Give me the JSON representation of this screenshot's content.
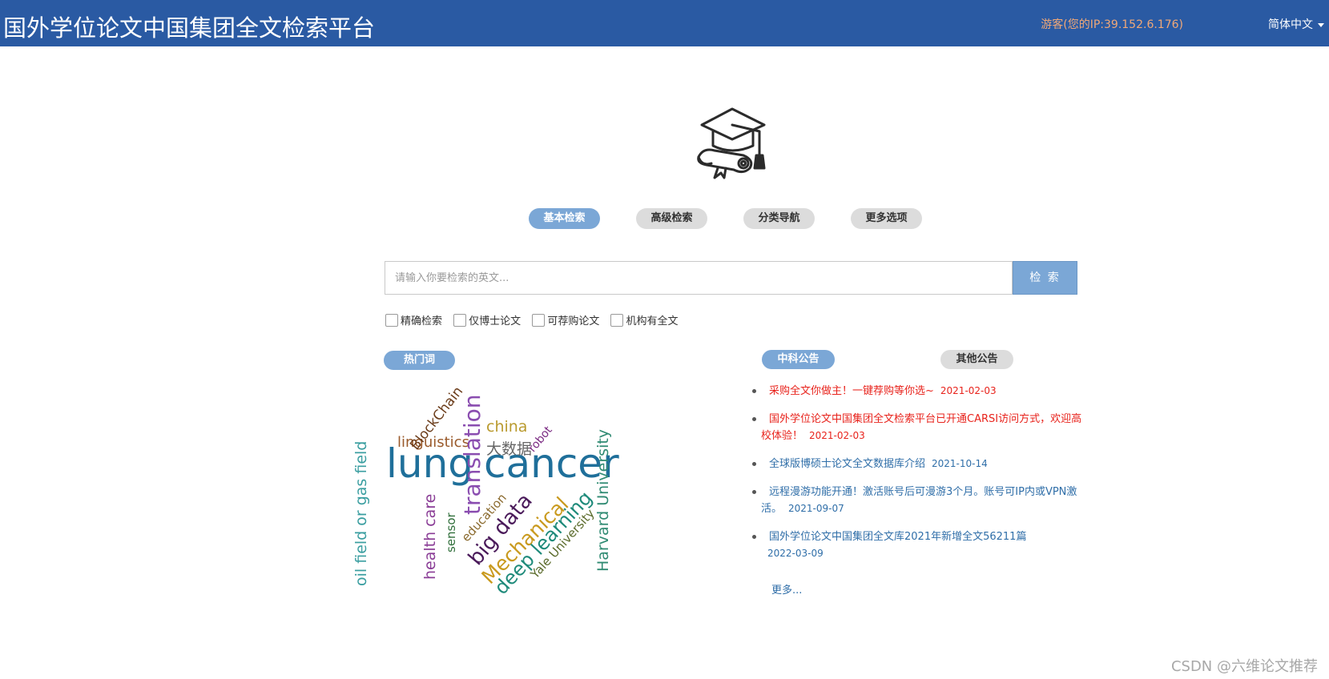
{
  "header": {
    "title": "国外学位论文中国集团全文检索平台",
    "visitor_info": "游客(您的IP:39.152.6.176)",
    "language": "简体中文"
  },
  "logo": {
    "icon": "graduation-cap-icon"
  },
  "tabs": [
    {
      "label": "基本检索",
      "active": true
    },
    {
      "label": "高级检索",
      "active": false
    },
    {
      "label": "分类导航",
      "active": false
    },
    {
      "label": "更多选项",
      "active": false
    }
  ],
  "search": {
    "placeholder": "请输入你要检索的英文...",
    "value": "",
    "button_label": "检 索"
  },
  "options": [
    {
      "label": "精确检索",
      "checked": false
    },
    {
      "label": "仅博士论文",
      "checked": false
    },
    {
      "label": "可荐购论文",
      "checked": false
    },
    {
      "label": "机构有全文",
      "checked": false
    }
  ],
  "hotwords": {
    "tab_label": "热门词",
    "words": [
      "lung",
      "cancer",
      "translation",
      "BlockChain",
      "linguistics",
      "china",
      "大数据",
      "robot",
      "oil field or gas field",
      "health care",
      "sensor",
      "education",
      "big data",
      "Mechanical",
      "deep learning",
      "Yale University",
      "Harvard University"
    ]
  },
  "announcements": {
    "tabs": [
      {
        "label": "中科公告",
        "active": true
      },
      {
        "label": "其他公告",
        "active": false
      }
    ],
    "items": [
      {
        "text": "采购全文你做主！一键荐购等你选~",
        "date": "2021-02-03",
        "color": "#e8231c"
      },
      {
        "text": "国外学位论文中国集团全文检索平台已开通CARSI访问方式，欢迎高校体验！",
        "date": "2021-02-03",
        "color": "#e8231c"
      },
      {
        "text": "全球版博硕士论文全文数据库介绍",
        "date": "2021-10-14",
        "color": "#2f6ea8"
      },
      {
        "text": "远程漫游功能开通！激活账号后可漫游3个月。账号可IP内或VPN激活。",
        "date": "2021-09-07",
        "color": "#2f6ea8"
      },
      {
        "text": "国外学位论文中国集团全文库2021年新增全文56211篇",
        "date": "2022-03-09",
        "color": "#2f6ea8"
      }
    ],
    "more_label": "更多..."
  },
  "watermark": "CSDN @六维论文推荐",
  "colors": {
    "header_bg": "#2a5aa3",
    "accent": "#7ba7d6",
    "link_blue": "#2f6ea8",
    "alert_red": "#e8231c"
  }
}
